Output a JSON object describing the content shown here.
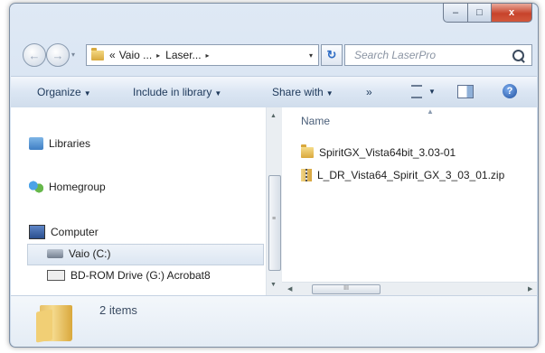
{
  "window": {
    "caption_buttons": {
      "minimize": "–",
      "maximize": "□",
      "close": "x"
    }
  },
  "address_bar": {
    "back_icon": "←",
    "forward_icon": "→",
    "prefix": "«",
    "crumbs": [
      "Vaio ...",
      "Laser..."
    ],
    "separator": "▸",
    "dropdown": "▾",
    "refresh_icon": "↻"
  },
  "search": {
    "placeholder": "Search LaserPro"
  },
  "toolbar": {
    "organize": "Organize",
    "include_in_library": "Include in library",
    "share_with": "Share with",
    "more": "»",
    "help": "?"
  },
  "nav_pane": {
    "items": [
      {
        "label": "Libraries",
        "icon": "libraries-icon"
      },
      {
        "label": "Homegroup",
        "icon": "homegroup-icon"
      },
      {
        "label": "Computer",
        "icon": "computer-icon"
      },
      {
        "label": "Vaio (C:)",
        "icon": "drive-icon"
      },
      {
        "label": "BD-ROM Drive (G:) Acrobat8",
        "icon": "bd-rom-icon"
      }
    ],
    "selected": "Vaio (C:)"
  },
  "content": {
    "column_header": "Name",
    "files": [
      {
        "name": "SpiritGX_Vista64bit_3.03-01",
        "type": "folder"
      },
      {
        "name": "L_DR_Vista64_Spirit_GX_3_03_01.zip",
        "type": "zip"
      }
    ]
  },
  "details": {
    "item_count": "2 items"
  },
  "scroll": {
    "hthumb_grip": "III"
  }
}
